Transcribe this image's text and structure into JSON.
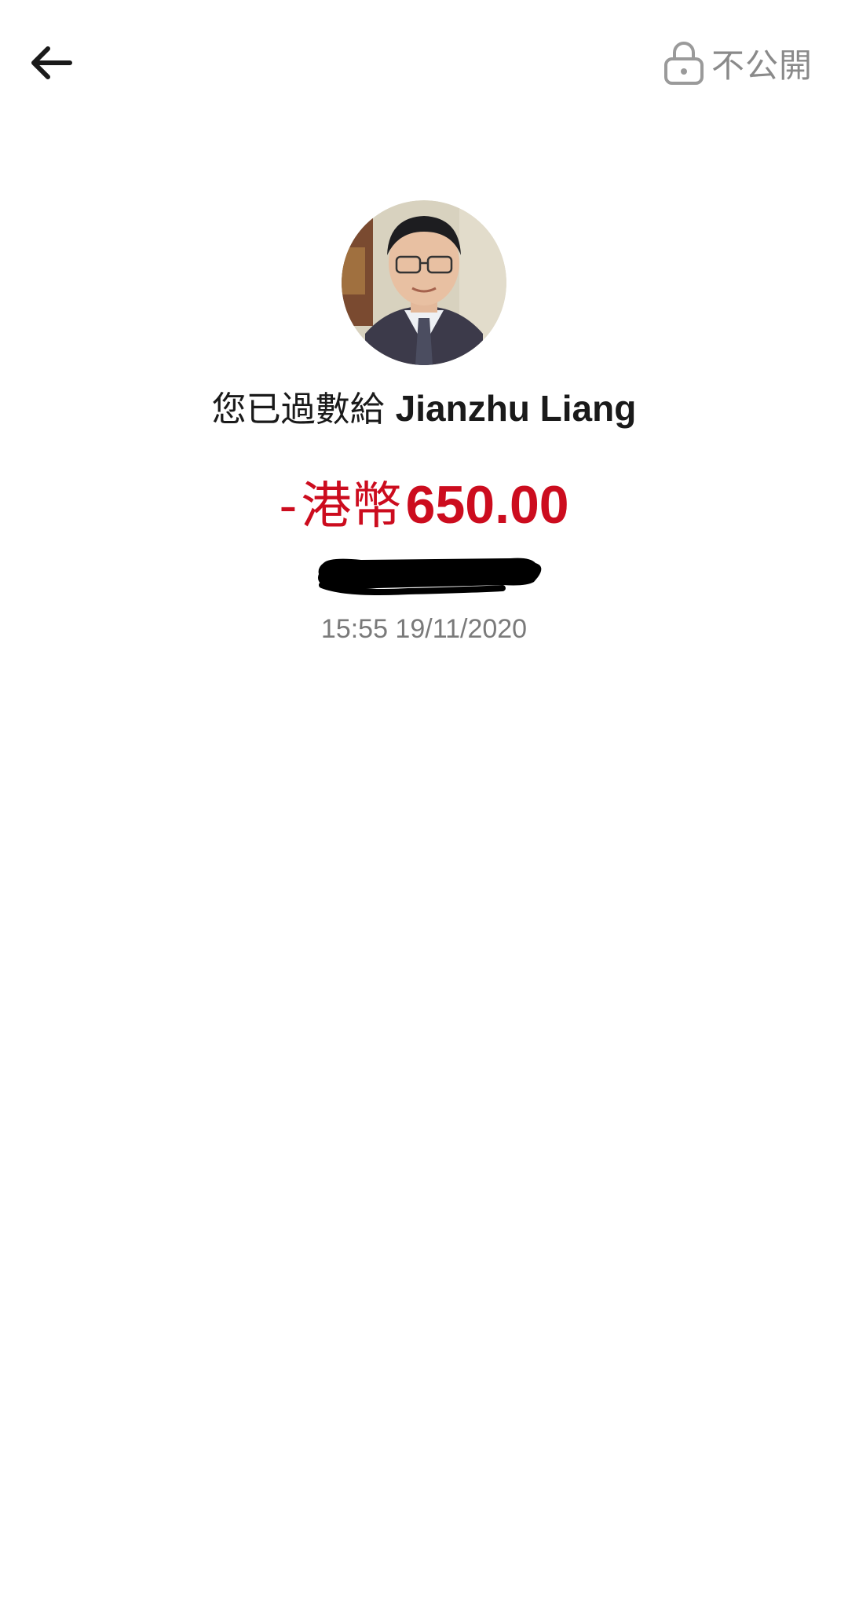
{
  "header": {
    "back_icon": "arrow-left-icon",
    "privacy_icon": "lock-icon",
    "privacy_label": "不公開"
  },
  "recipient": {
    "prefix": "您已過數給",
    "name": "Jianzhu Liang",
    "avatar": "profile-photo"
  },
  "transaction": {
    "sign": "-",
    "currency": "港幣",
    "amount": "650.00",
    "timestamp": "15:55 19/11/2020"
  },
  "colors": {
    "amount": "#cc0c1e",
    "secondary_text": "#7a7a7a",
    "primary_text": "#1a1a1a"
  }
}
